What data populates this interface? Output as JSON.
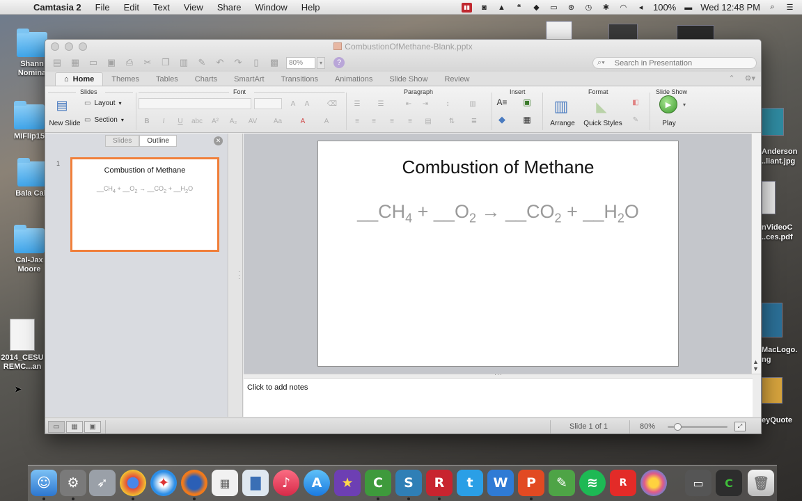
{
  "menubar": {
    "app_name": "Camtasia 2",
    "items": [
      "File",
      "Edit",
      "Text",
      "View",
      "Share",
      "Window",
      "Help"
    ],
    "battery": "100%",
    "clock": "Wed 12:48 PM"
  },
  "desktop": {
    "left_icons": [
      {
        "label": "Shann Nomina",
        "kind": "folder"
      },
      {
        "label": "MIFlip15",
        "kind": "folder"
      },
      {
        "label": "Bala Calc",
        "kind": "folder"
      },
      {
        "label": "Cal-Jax Moore",
        "kind": "folder"
      },
      {
        "label": "2014_CESU REMC...an",
        "kind": "document"
      }
    ],
    "right_labels": [
      {
        "label": "Anderson ..liant.jpg"
      },
      {
        "label": "nVideoC ..ces.pdf"
      },
      {
        "label": "MacLogo. ng"
      },
      {
        "label": "eyQuote"
      }
    ]
  },
  "window": {
    "doc_title": "CombustionOfMethane-Blank.pptx",
    "zoom": "80%",
    "search_placeholder": "Search in Presentation",
    "tabs": [
      "Home",
      "Themes",
      "Tables",
      "Charts",
      "SmartArt",
      "Transitions",
      "Animations",
      "Slide Show",
      "Review"
    ],
    "active_tab": "Home",
    "groups": {
      "slides": "Slides",
      "font": "Font",
      "paragraph": "Paragraph",
      "insert": "Insert",
      "format": "Format",
      "slideshow": "Slide Show"
    },
    "buttons": {
      "new_slide": "New Slide",
      "layout": "Layout",
      "section": "Section",
      "arrange": "Arrange",
      "quick_styles": "Quick Styles",
      "play": "Play"
    },
    "pane_tabs": [
      "Slides",
      "Outline"
    ],
    "active_pane_tab": "Outline"
  },
  "slide": {
    "number": "1",
    "title": "Combustion of Methane",
    "equation_parts": {
      "blank": "__",
      "ch": "CH",
      "ch_sub": "4",
      "plus1": " + ",
      "o": "O",
      "o_sub": "2",
      "arrow": " → ",
      "co": "CO",
      "co_sub": "2",
      "plus2": " + ",
      "h": "H",
      "h_sub": "2",
      "o_end": "O"
    }
  },
  "notes_placeholder": "Click to add notes",
  "statusbar": {
    "slide_info": "Slide 1 of 1",
    "zoom": "80%"
  },
  "dock": {
    "apps": [
      "Finder",
      "System Preferences",
      "Launchpad",
      "Chrome",
      "Safari",
      "Firefox",
      "Launchpad Grid",
      "Keynote",
      "iTunes",
      "App Store",
      "iMovie",
      "Camtasia",
      "Snagit",
      "Ruby",
      "Twitter",
      "Word",
      "PowerPoint",
      "Evernote",
      "Spotify",
      "Roblox",
      "Photos",
      "Screen",
      "Camtasia Recorder",
      "Trash"
    ]
  },
  "colors": {
    "accent_selection": "#f07f3a",
    "play_green": "#3d9a2e"
  }
}
